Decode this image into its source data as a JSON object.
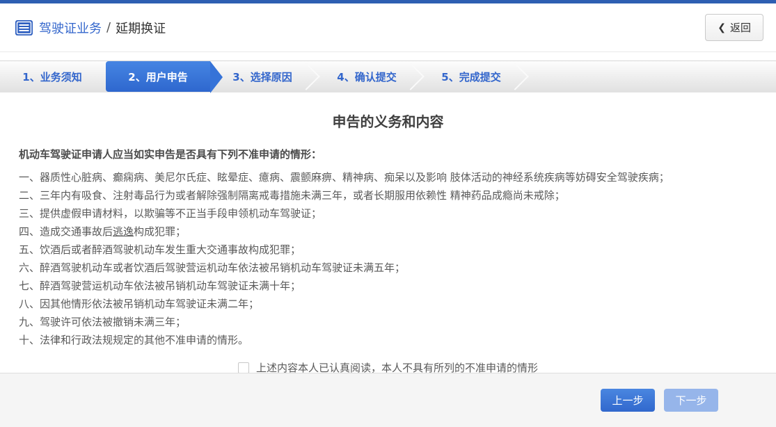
{
  "colors": {
    "topbar_blue": "#2e5fb2",
    "accent_blue": "#3366cc",
    "active_step_blue": "#3a74d9",
    "primary_button_blue": "#3b76d6",
    "disabled_button_blue": "#96b5ea",
    "footer_gray": "#f5f5f5",
    "body_text_gray": "#595959"
  },
  "header": {
    "icon": "list-icon",
    "title_primary": "驾驶证业务",
    "separator": "/",
    "title_secondary": "延期换证",
    "back": {
      "chevron": "❮",
      "label": "返回"
    }
  },
  "wizard": {
    "steps": [
      {
        "label": "1、业务须知",
        "state": "inactive"
      },
      {
        "label": "2、用户申告",
        "state": "active"
      },
      {
        "label": "3、选择原因",
        "state": "inactive"
      },
      {
        "label": "4、确认提交",
        "state": "inactive"
      },
      {
        "label": "5、完成提交",
        "state": "inactive"
      }
    ]
  },
  "content": {
    "title": "申告的义务和内容",
    "intro": "机动车驾驶证申请人应当如实申告是否具有下列不准申请的情形：",
    "items": [
      {
        "text": "一、器质性心脏病、癫痫病、美尼尔氏症、眩晕症、癔病、震颤麻痹、精神病、痴呆以及影响 肢体活动的神经系统疾病等妨碍安全驾驶疾病；"
      },
      {
        "text": "二、三年内有吸食、注射毒品行为或者解除强制隔离戒毒措施未满三年，或者长期服用依赖性 精神药品成瘾尚未戒除；"
      },
      {
        "text": "三、提供虚假申请材料，以欺骗等不正当手段申领机动车驾驶证；"
      },
      {
        "pre": "四、造成交通事故后",
        "underlined": "逃逸",
        "post": "构成犯罪；"
      },
      {
        "text": "五、饮酒后或者醉酒驾驶机动车发生重大交通事故构成犯罪；"
      },
      {
        "text": "六、醉酒驾驶机动车或者饮酒后驾驶营运机动车依法被吊销机动车驾驶证未满五年；"
      },
      {
        "text": "七、醉酒驾驶营运机动车依法被吊销机动车驾驶证未满十年；"
      },
      {
        "text": "八、因其他情形依法被吊销机动车驾驶证未满二年；"
      },
      {
        "text": "九、驾驶许可依法被撤销未满三年；"
      },
      {
        "text": "十、法律和行政法规规定的其他不准申请的情形。"
      }
    ],
    "checkbox": {
      "checked": false,
      "label": "上述内容本人已认真阅读，本人不具有所列的不准申请的情形"
    }
  },
  "footer": {
    "prev_label": "上一步",
    "next_label": "下一步",
    "next_disabled": true
  }
}
